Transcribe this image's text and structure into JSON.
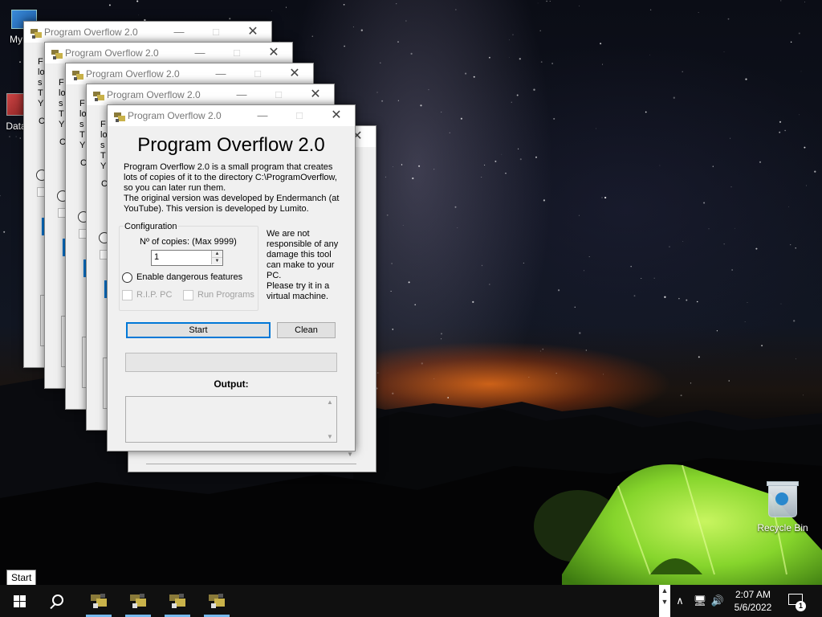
{
  "desktop": {
    "icons": {
      "my_pc": "My C",
      "data": "Data",
      "recycle_bin": "Recycle Bin"
    }
  },
  "window": {
    "title": "Program Overflow 2.0",
    "heading": "Program Overflow 2.0",
    "description": [
      "Program Overflow 2.0 is a small program that creates",
      "lots of copies of it to the directory C:\\ProgramOverflow,",
      "so you can later run them.",
      "The original version was developed by Endermanch (at",
      "YouTube). This version is developed by Lumito."
    ],
    "config": {
      "legend": "Configuration",
      "copies_label": "Nº of copies: (Max 9999)",
      "copies_value": "1",
      "dangerous_label": "Enable dangerous features",
      "rip_label": "R.I.P. PC",
      "run_label": "Run Programs"
    },
    "warning": [
      "We are not",
      "responsible of any",
      "damage this tool",
      "can make to your",
      "PC.",
      "Please try it in a",
      "virtual machine."
    ],
    "start_button": "Start",
    "clean_button": "Clean",
    "progress": 0,
    "output_label": "Output:",
    "output_text": "",
    "ghost_letters": [
      "F",
      "lo",
      "s",
      "T",
      "Y"
    ],
    "ghost_config_letter": "C"
  },
  "taskbar": {
    "tooltip": "Start",
    "app_count": 4,
    "clock_time": "2:07 AM",
    "clock_date": "5/6/2022",
    "notification_count": "1"
  },
  "colors": {
    "accent": "#0078d7",
    "taskbar": "#101010",
    "tent_green": "#9be33c"
  }
}
